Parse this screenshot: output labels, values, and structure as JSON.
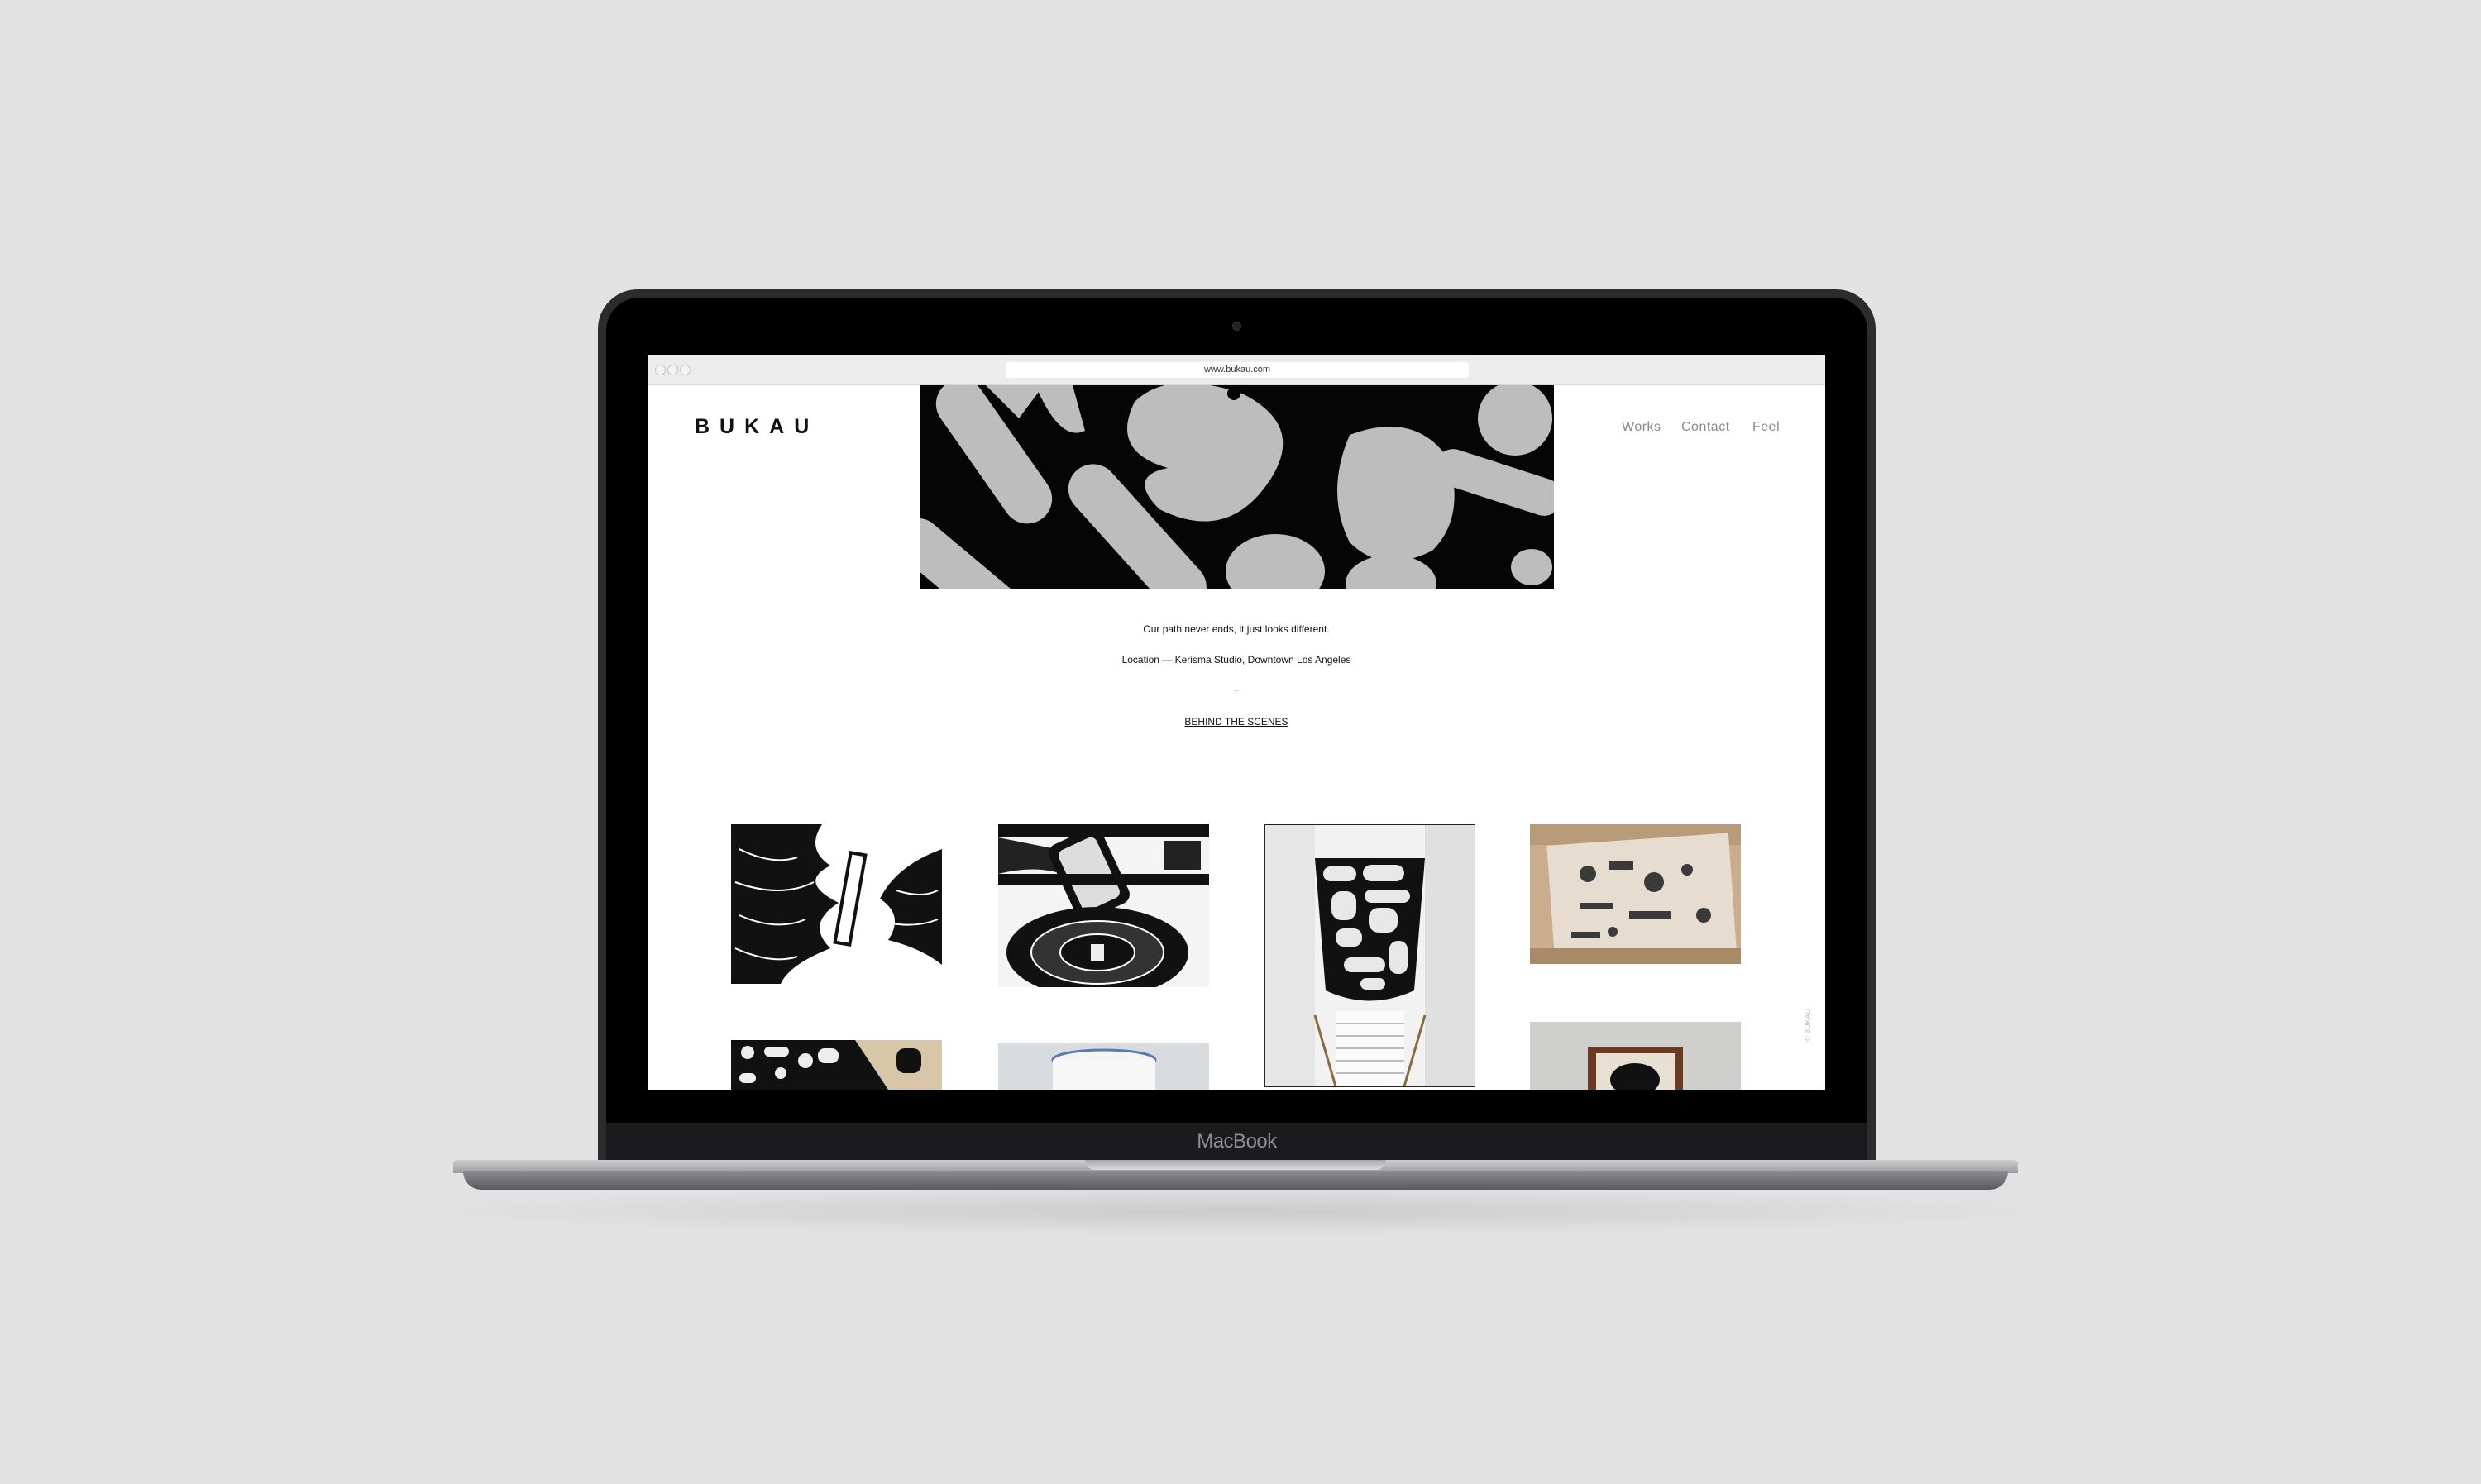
{
  "device": {
    "brand_label": "MacBook"
  },
  "browser": {
    "url": "www.bukau.com"
  },
  "site": {
    "logo": "BUKAU",
    "nav": [
      "Works",
      "Contact",
      "Feel"
    ],
    "tagline": "Our path never ends, it just looks different.",
    "location": "Location — Kerisma Studio, Downtown Los Angeles",
    "separator": "..",
    "behind_link": "BEHIND THE SCENES",
    "vertical_text": "© BUKAU"
  },
  "colors": {
    "background": "#e2e2e2",
    "screen": "#ffffff",
    "ink": "#111111",
    "nav": "#8a8a8a"
  }
}
